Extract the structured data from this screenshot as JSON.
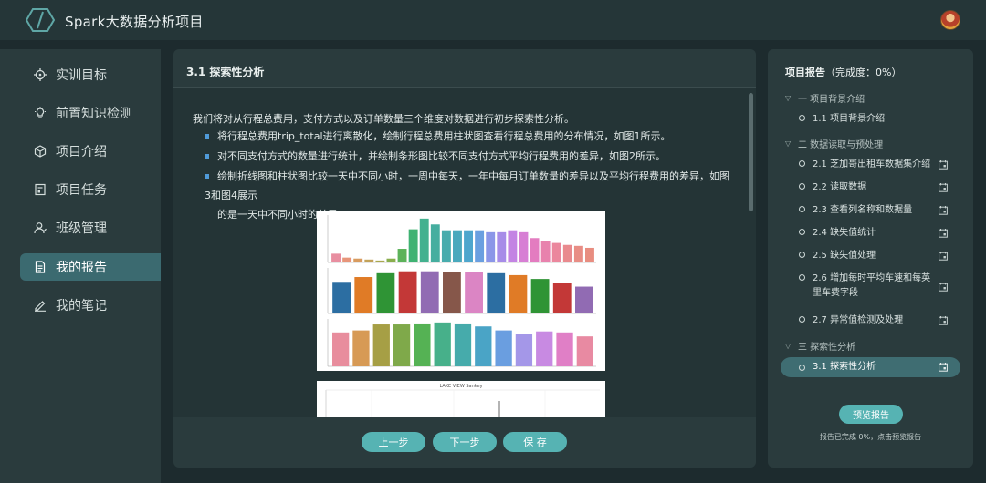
{
  "app": {
    "title": "Spark大数据分析项目"
  },
  "sidebar": {
    "items": [
      {
        "label": "实训目标",
        "icon": "target-icon"
      },
      {
        "label": "前置知识检测",
        "icon": "bulb-icon"
      },
      {
        "label": "项目介绍",
        "icon": "cube-icon"
      },
      {
        "label": "项目任务",
        "icon": "task-icon"
      },
      {
        "label": "班级管理",
        "icon": "users-icon"
      },
      {
        "label": "我的报告",
        "icon": "document-icon",
        "active": true
      },
      {
        "label": "我的笔记",
        "icon": "pen-icon"
      }
    ]
  },
  "main": {
    "title": "3.1 探索性分析",
    "intro": "我们将对从行程总费用，支付方式以及订单数量三个维度对数据进行初步探索性分析。",
    "bullets": [
      {
        "text": "将行程总费用trip_total进行离散化，绘制行程总费用柱状图查看行程总费用的分布情况，如图1所示。"
      },
      {
        "text": "对不同支付方式的数量进行统计，并绘制条形图比较不同支付方式平均行程费用的差异，如图2所示。"
      },
      {
        "text": "绘制折线图和柱状图比较一天中不同小时，一周中每天，一年中每月订单数量的差异以及平均行程费用的差异，如图3和图4展示",
        "cont": "的是一天中不同小时的差异。"
      }
    ],
    "chart2_title": "LAKE VIEW Sankey",
    "buttons": {
      "prev": "上一步",
      "next": "下一步",
      "save": "保 存"
    }
  },
  "report": {
    "title": "项目报告",
    "completion": "（完成度：0%）",
    "sections": [
      {
        "label": "一 项目背景介绍",
        "items": [
          {
            "label": "1.1 项目背景介绍",
            "has_report": false
          }
        ]
      },
      {
        "label": "二 数据读取与预处理",
        "items": [
          {
            "label": "2.1 芝加哥出租车数据集介绍",
            "has_report": true
          },
          {
            "label": "2.2 读取数据",
            "has_report": true
          },
          {
            "label": "2.3 查看列名称和数据量",
            "has_report": true
          },
          {
            "label": "2.4 缺失值统计",
            "has_report": true
          },
          {
            "label": "2.5 缺失值处理",
            "has_report": true
          },
          {
            "label": "2.6 增加每时平均车速和每英里车费字段",
            "has_report": true
          },
          {
            "label": "2.7 异常值检测及处理",
            "has_report": true
          }
        ]
      },
      {
        "label": "三 探索性分析",
        "items": [
          {
            "label": "3.1 探索性分析",
            "has_report": true,
            "active": true
          }
        ]
      }
    ],
    "preview_button": "预览报告",
    "preview_note": "报告已完成 0%，点击预览报告"
  },
  "chart_data": [
    {
      "type": "bar",
      "title": "",
      "values": [
        9,
        5,
        4,
        3,
        2,
        4,
        14,
        34,
        45,
        39,
        33,
        33,
        33,
        33,
        31,
        31,
        33,
        31,
        25,
        22,
        20,
        18,
        17,
        15
      ],
      "colors": [
        "#e88ea0",
        "#e7957a",
        "#d89b5f",
        "#c2a259",
        "#a9a84f",
        "#89ae4d",
        "#5cb25a",
        "#3fb272",
        "#43b18f",
        "#45ae9f",
        "#48acad",
        "#4aa9bd",
        "#4ea6cd",
        "#6a9fe0",
        "#8b96e8",
        "#a78ce8",
        "#c384e3",
        "#d77fd4",
        "#e37cc0",
        "#e882ad",
        "#eb879d",
        "#e98a8e",
        "#e88d85",
        "#e88d80"
      ]
    },
    {
      "type": "bar",
      "title": "",
      "values": [
        33,
        38,
        42,
        44,
        44,
        43,
        43,
        42,
        40,
        36,
        32,
        28
      ],
      "colors": [
        "#2c6ea2",
        "#e07b26",
        "#2f9435",
        "#c33837",
        "#916bb3",
        "#86574a",
        "#db85c4"
      ]
    },
    {
      "type": "bar",
      "title": "",
      "values": [
        34,
        36,
        42,
        42,
        43,
        44,
        43,
        40,
        36,
        32,
        35,
        34,
        30
      ],
      "colors": [
        "#e88d9d",
        "#d79a55",
        "#a69f45",
        "#7fa94a",
        "#55b254",
        "#47b08a",
        "#46abab",
        "#4aa4c6",
        "#6a9ee0",
        "#a497e8",
        "#c88ae2",
        "#e07fc6",
        "#e88aa2"
      ]
    }
  ]
}
